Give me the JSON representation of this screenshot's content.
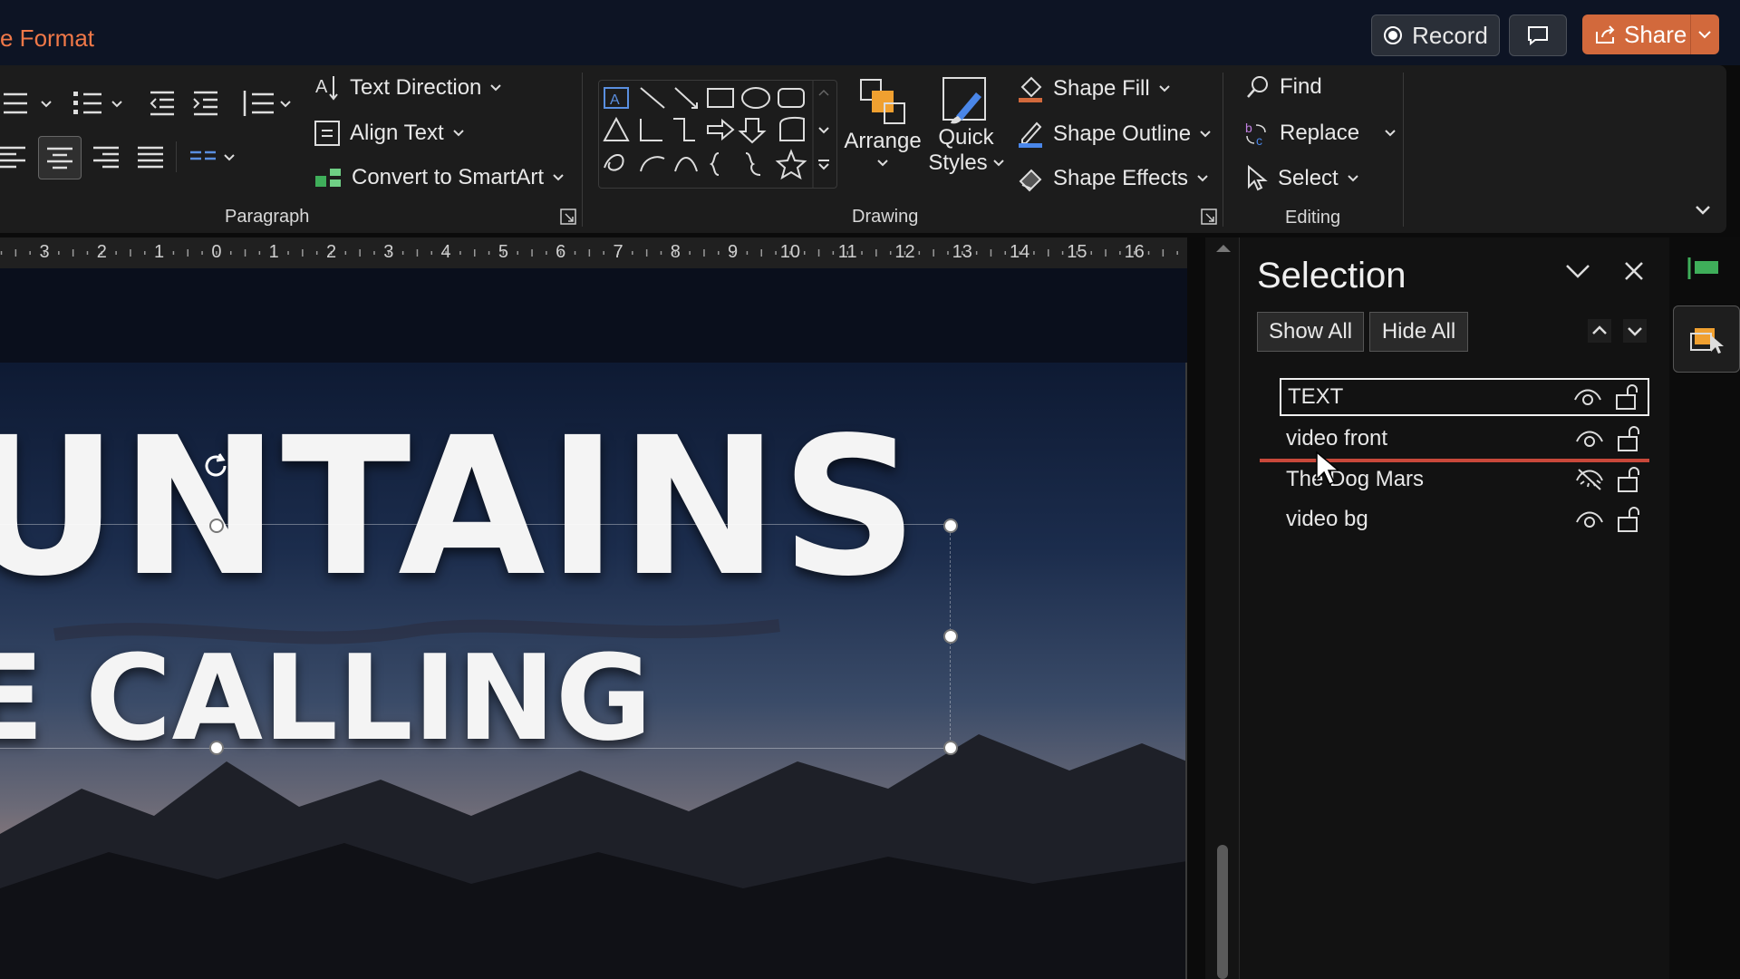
{
  "titlebar": {
    "tab_label": "e Format",
    "record_label": "Record",
    "share_label": "Share"
  },
  "ribbon": {
    "paragraph": {
      "text_direction": "Text Direction",
      "align_text": "Align Text",
      "convert_smartart": "Convert to SmartArt",
      "group_label": "Paragraph"
    },
    "drawing": {
      "arrange": "Arrange",
      "quick_styles_line1": "Quick",
      "quick_styles_line2": "Styles",
      "shape_fill": "Shape Fill",
      "shape_outline": "Shape Outline",
      "shape_effects": "Shape Effects",
      "group_label": "Drawing"
    },
    "editing": {
      "find": "Find",
      "replace": "Replace",
      "select": "Select",
      "group_label": "Editing"
    }
  },
  "ruler": {
    "numbers": [
      "3",
      "2",
      "1",
      "0",
      "1",
      "2",
      "3",
      "4",
      "5",
      "6",
      "7",
      "8",
      "9",
      "10",
      "11",
      "12",
      "13",
      "14",
      "15",
      "16"
    ]
  },
  "slide": {
    "line1": "UNTAINS",
    "line2": "E CALLING"
  },
  "selection_pane": {
    "title": "Selection",
    "show_all": "Show All",
    "hide_all": "Hide All",
    "layers": [
      {
        "name": "TEXT",
        "visible": true,
        "selected": true
      },
      {
        "name": "video front",
        "visible": true,
        "selected": false
      },
      {
        "name": "The Dog Mars",
        "visible": false,
        "selected": false
      },
      {
        "name": "video bg",
        "visible": true,
        "selected": false
      }
    ]
  },
  "colors": {
    "accent": "#d2693c",
    "tab": "#f07848",
    "drop_indicator": "#c8483a"
  }
}
